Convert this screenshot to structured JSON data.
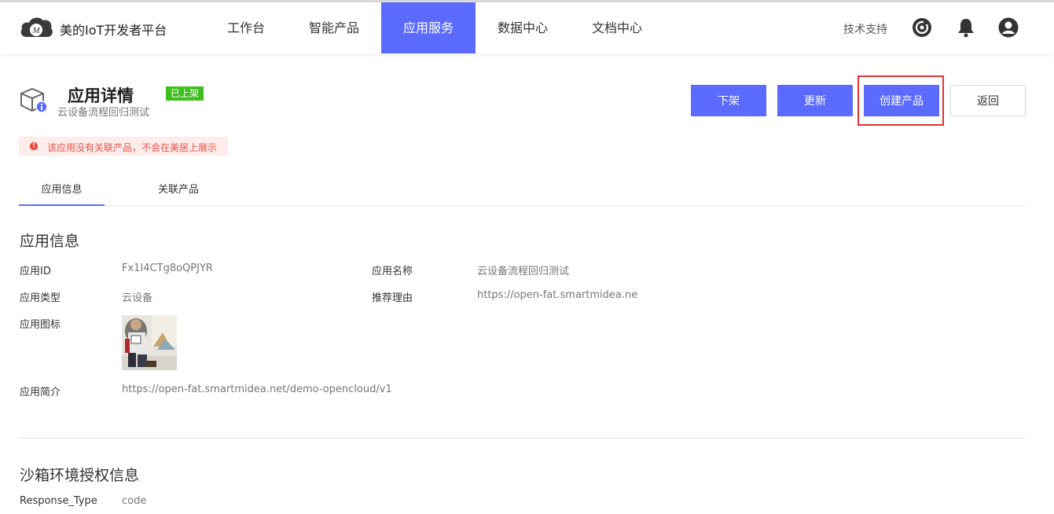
{
  "header": {
    "brand": "美的IoT开发者平台",
    "nav": [
      "工作台",
      "智能产品",
      "应用服务",
      "数据中心",
      "文档中心"
    ],
    "active_nav": "应用服务",
    "support": "技术支持",
    "icons": [
      "target-icon",
      "bell-icon",
      "user-avatar-icon"
    ]
  },
  "page": {
    "title": "应用详情",
    "status": "已上架",
    "subtitle": "云设备流程回归测试",
    "buttons": {
      "delist": "下架",
      "update": "更新",
      "create_product": "创建产品",
      "back": "返回"
    },
    "alert": "该应用没有关联产品，不会在美居上展示"
  },
  "tabs": [
    "应用信息",
    "关联产品"
  ],
  "app_info": {
    "section_title": "应用信息",
    "app_id_label": "应用ID",
    "app_id": "Fx1I4CTg8oQPJYR",
    "app_name_label": "应用名称",
    "app_name": "云设备流程回归测试",
    "app_type_label": "应用类型",
    "app_type": "云设备",
    "reason_label": "推荐理由",
    "reason": "https://open-fat.smartmidea.ne",
    "icon_label": "应用图标",
    "intro_label": "应用简介",
    "intro": "https://open-fat.smartmidea.net/demo-opencloud/v1"
  },
  "sandbox": {
    "section_title": "沙箱环境授权信息",
    "response_type_label": "Response_Type",
    "response_type": "code"
  },
  "colors": {
    "primary": "#5b6bff",
    "badge": "#3fbf1f",
    "alert_bg": "#fdecea",
    "alert_text": "#e5534b",
    "highlight": "#e03131"
  }
}
